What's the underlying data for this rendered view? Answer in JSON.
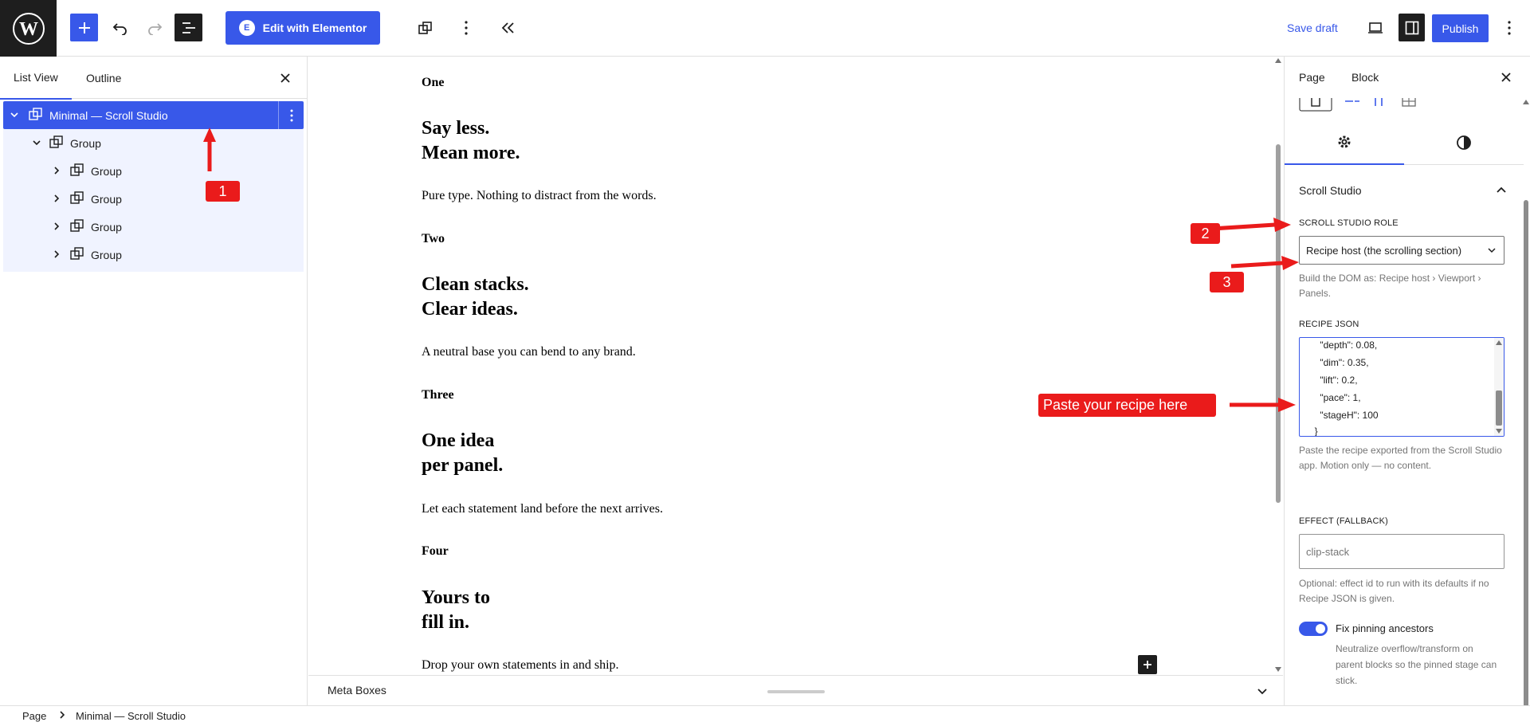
{
  "toolbar": {
    "elementor_label": "Edit with Elementor",
    "save_draft": "Save draft",
    "publish": "Publish"
  },
  "left_panel": {
    "tabs": [
      "List View",
      "Outline"
    ],
    "tree": [
      {
        "label": "Minimal — Scroll Studio",
        "level": 1,
        "expanded": true,
        "selected": true
      },
      {
        "label": "Group",
        "level": 2,
        "expanded": true
      },
      {
        "label": "Group",
        "level": 3,
        "expanded": false
      },
      {
        "label": "Group",
        "level": 3,
        "expanded": false
      },
      {
        "label": "Group",
        "level": 3,
        "expanded": false
      },
      {
        "label": "Group",
        "level": 3,
        "expanded": false
      }
    ]
  },
  "canvas": {
    "sections": [
      {
        "label": "One",
        "heading": "Say less.\nMean more.",
        "text": "Pure type. Nothing to distract from the words."
      },
      {
        "label": "Two",
        "heading": "Clean stacks.\nClear ideas.",
        "text": "A neutral base you can bend to any brand."
      },
      {
        "label": "Three",
        "heading": "One idea\nper panel.",
        "text": "Let each statement land before the next arrives."
      },
      {
        "label": "Four",
        "heading": "Yours to\nfill in.",
        "text": "Drop your own statements in and ship."
      }
    ],
    "meta_boxes": "Meta Boxes"
  },
  "right_panel": {
    "tabs": [
      "Page",
      "Block"
    ],
    "panel_title": "Scroll Studio",
    "role_label": "SCROLL STUDIO ROLE",
    "role_value": "Recipe host (the scrolling section)",
    "role_help": "Build the DOM as: Recipe host › Viewport › Panels.",
    "json_label": "RECIPE JSON",
    "json_lines": [
      "    \"depth\": 0.08,",
      "    \"dim\": 0.35,",
      "    \"lift\": 0.2,",
      "    \"pace\": 1,",
      "    \"stageH\": 100",
      "  }",
      "}"
    ],
    "json_help": "Paste the recipe exported from the Scroll Studio app. Motion only — no content.",
    "effect_label": "EFFECT (FALLBACK)",
    "effect_placeholder": "clip-stack",
    "effect_help": "Optional: effect id to run with its defaults if no Recipe JSON is given.",
    "toggle_label": "Fix pinning ancestors",
    "toggle_on": true,
    "toggle_help": "Neutralize overflow/transform on parent blocks so the pinned stage can stick."
  },
  "breadcrumb": [
    "Page",
    "Minimal — Scroll Studio"
  ],
  "annotations": {
    "badges": [
      "1",
      "2",
      "3"
    ],
    "note": "Paste your recipe here"
  },
  "colors": {
    "accent": "#3858e9",
    "annotation": "#ea1b1b",
    "dark": "#1e1e1e"
  }
}
